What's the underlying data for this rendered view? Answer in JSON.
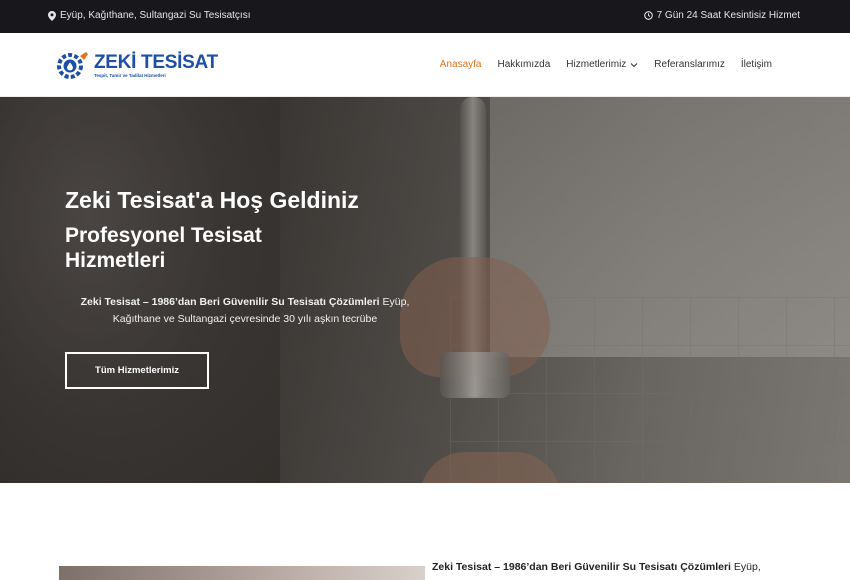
{
  "topbar": {
    "location_icon": "map-pin-icon",
    "location_text": "Eyüp, Kağıthane, Sultangazi Su Tesisatçısı",
    "clock_icon": "clock-icon",
    "service_text": "7 Gün 24 Saat Kesintisiz Hizmet"
  },
  "header": {
    "logo_title": "ZEKİ TESİSAT",
    "logo_subtitle": "Tespit, Tamir ve Tadilat Hizmetleri",
    "nav": [
      {
        "label": "Anasayfa",
        "active": true
      },
      {
        "label": "Hakkımızda",
        "active": false
      },
      {
        "label": "Hizmetlerimiz",
        "active": false,
        "has_dropdown": true
      },
      {
        "label": "Referanslarımız",
        "active": false
      },
      {
        "label": "İletişim",
        "active": false
      }
    ]
  },
  "hero": {
    "title": "Zeki Tesisat'a Hoş Geldiniz",
    "subtitle": "Profesyonel Tesisat Hizmetleri",
    "desc_bold": "Zeki Tesisat – 1986’dan Beri Güvenilir Su Tesisatı Çözümleri",
    "desc_rest": " Eyüp, Kağıthane ve Sultangazi çevresinde 30 yılı aşkın tecrübe",
    "button_label": "Tüm Hizmetlerimiz"
  },
  "about": {
    "text_bold": "Zeki Tesisat – 1986’dan Beri Güvenilir Su Tesisatı Çözümleri",
    "text_rest": " Eyüp,"
  },
  "colors": {
    "accent": "#e2731d",
    "brand_blue": "#1b4fa8",
    "topbar_bg": "#17171c"
  }
}
